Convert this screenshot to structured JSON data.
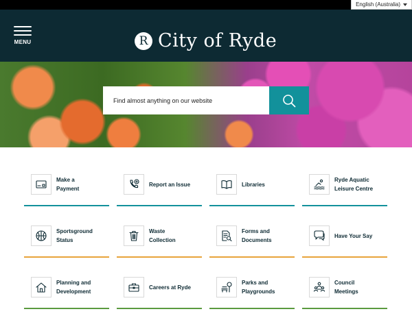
{
  "language": {
    "selected": "English (Australia)"
  },
  "header": {
    "menu_label": "MENU",
    "logo_letter": "R",
    "site_title": "City of Ryde"
  },
  "search": {
    "placeholder": "Find almost anything on our website"
  },
  "colors": {
    "header_bg": "#0d2a33",
    "teal": "#12919b",
    "orange": "#e8a33a",
    "green": "#5a9a3e"
  },
  "tiles": [
    {
      "label_lines": [
        "Make a",
        "Payment"
      ],
      "icon": "payment-card-icon",
      "accent": "teal"
    },
    {
      "label_lines": [
        "Report an Issue"
      ],
      "icon": "phone-report-icon",
      "accent": "teal"
    },
    {
      "label_lines": [
        "Libraries"
      ],
      "icon": "open-book-icon",
      "accent": "teal"
    },
    {
      "label_lines": [
        "Ryde Aquatic",
        "Leisure Centre"
      ],
      "icon": "swimmer-icon",
      "accent": "teal"
    },
    {
      "label_lines": [
        "Sportsground",
        "Status"
      ],
      "icon": "basketball-icon",
      "accent": "orange"
    },
    {
      "label_lines": [
        "Waste",
        "Collection"
      ],
      "icon": "bin-icon",
      "accent": "orange"
    },
    {
      "label_lines": [
        "Forms and",
        "Documents"
      ],
      "icon": "document-search-icon",
      "accent": "orange"
    },
    {
      "label_lines": [
        "Have Your Say"
      ],
      "icon": "speech-bubbles-icon",
      "accent": "orange"
    },
    {
      "label_lines": [
        "Planning and",
        "Development"
      ],
      "icon": "house-icon",
      "accent": "green"
    },
    {
      "label_lines": [
        "Careers at Ryde"
      ],
      "icon": "briefcase-icon",
      "accent": "green"
    },
    {
      "label_lines": [
        "Parks and",
        "Playgrounds"
      ],
      "icon": "park-bench-icon",
      "accent": "green"
    },
    {
      "label_lines": [
        "Council",
        "Meetings"
      ],
      "icon": "meeting-people-icon",
      "accent": "green"
    }
  ]
}
